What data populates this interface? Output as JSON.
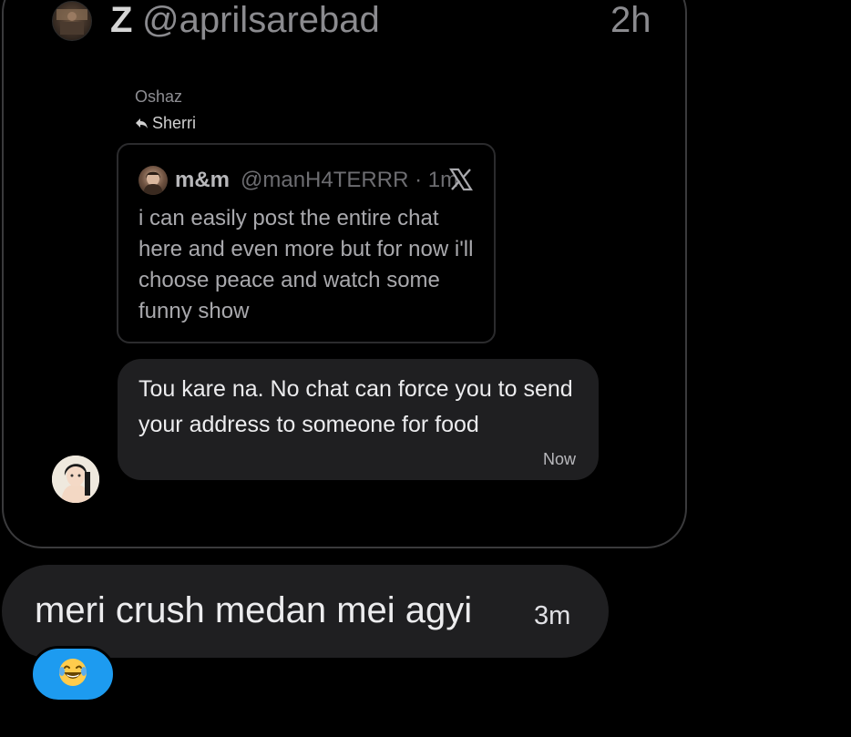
{
  "shared_post": {
    "author_initial": "Z",
    "author_handle": "@aprilsarebad",
    "time": "2h",
    "sender_name": "Oshaz",
    "reply_to": "Sherri",
    "quoted_tweet": {
      "name": "m&m",
      "handle_time": "@manH4TERRR · 1m",
      "text": "i can easily post the entire chat here and even more but for now i'll choose peace and watch some funny show"
    },
    "reply_message": {
      "text": "Tou kare na. No chat can force you to send your address to someone for food",
      "time": "Now"
    }
  },
  "message": {
    "text": "meri crush medan mei agyi",
    "time": "3m"
  },
  "reaction": {
    "emoji": "😂",
    "icon": "laughing-tears-icon",
    "color": "#1d9bf0"
  },
  "colors": {
    "background": "#000000",
    "bubble": "#1f1f21",
    "border": "#3a3a3c",
    "accent": "#1d9bf0"
  }
}
